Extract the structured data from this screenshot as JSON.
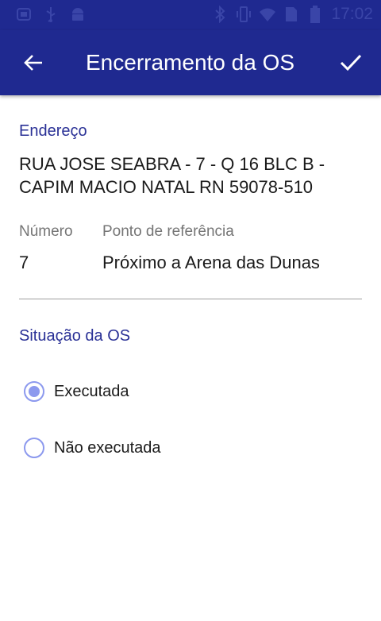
{
  "status_bar": {
    "time": "17:02",
    "icons_left": [
      "tray-icon",
      "usb-icon",
      "android-icon"
    ],
    "icons_right": [
      "bluetooth-icon",
      "vibrate-icon",
      "wifi-icon",
      "sim-icon",
      "battery-icon"
    ]
  },
  "app_bar": {
    "title": "Encerramento da OS",
    "back_icon": "arrow-back-icon",
    "confirm_icon": "check-icon",
    "color": "#1f2990"
  },
  "address": {
    "label": "Endereço",
    "value": "RUA JOSE SEABRA - 7 - Q 16 BLC B - CAPIM MACIO NATAL RN 59078-510"
  },
  "number": {
    "label": "Número",
    "value": "7"
  },
  "reference": {
    "label": "Ponto de referência",
    "value": "Próximo a Arena das Dunas"
  },
  "situation": {
    "label": "Situação da OS",
    "options": [
      {
        "label": "Executada",
        "selected": true
      },
      {
        "label": "Não executada",
        "selected": false
      }
    ]
  },
  "colors": {
    "accent": "#2a3196",
    "radio": "#8c99ee"
  }
}
